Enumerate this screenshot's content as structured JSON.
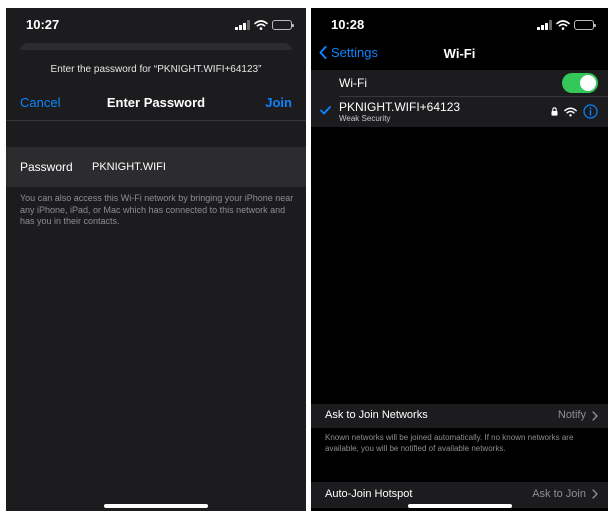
{
  "left": {
    "status": {
      "time": "10:27"
    },
    "prompt": "Enter the password for “PKNIGHT.WIFI+64123”",
    "nav": {
      "cancel_label": "Cancel",
      "title": "Enter Password",
      "join_label": "Join"
    },
    "password": {
      "label": "Password",
      "value": "PKNIGHT.WIFI"
    },
    "footnote": "You can also access this Wi-Fi network by bringing your iPhone near any iPhone, iPad, or Mac which has connected to this network and has you in their contacts."
  },
  "right": {
    "status": {
      "time": "10:28"
    },
    "nav": {
      "back_label": "Settings",
      "title": "Wi-Fi"
    },
    "wifi": {
      "label": "Wi-Fi",
      "enabled": true
    },
    "network": {
      "name": "PKNIGHT.WIFI+64123",
      "security": "Weak Security"
    },
    "ask_to_join": {
      "label": "Ask to Join Networks",
      "value": "Notify"
    },
    "known_note": "Known networks will be joined automatically. If no known networks are available, you will be notified of available networks.",
    "auto_join": {
      "label": "Auto-Join Hotspot",
      "value": "Ask to Join"
    }
  },
  "colors": {
    "accent": "#0a84ff",
    "toggle_on": "#34c759",
    "secondary_text": "#8e8e93",
    "cell_background": "#1c1c1e"
  },
  "icons": [
    "cellular-signal-icon",
    "wifi-icon",
    "battery-icon",
    "chevron-left-icon",
    "checkmark-icon",
    "lock-icon",
    "info-icon",
    "chevron-right-icon"
  ]
}
